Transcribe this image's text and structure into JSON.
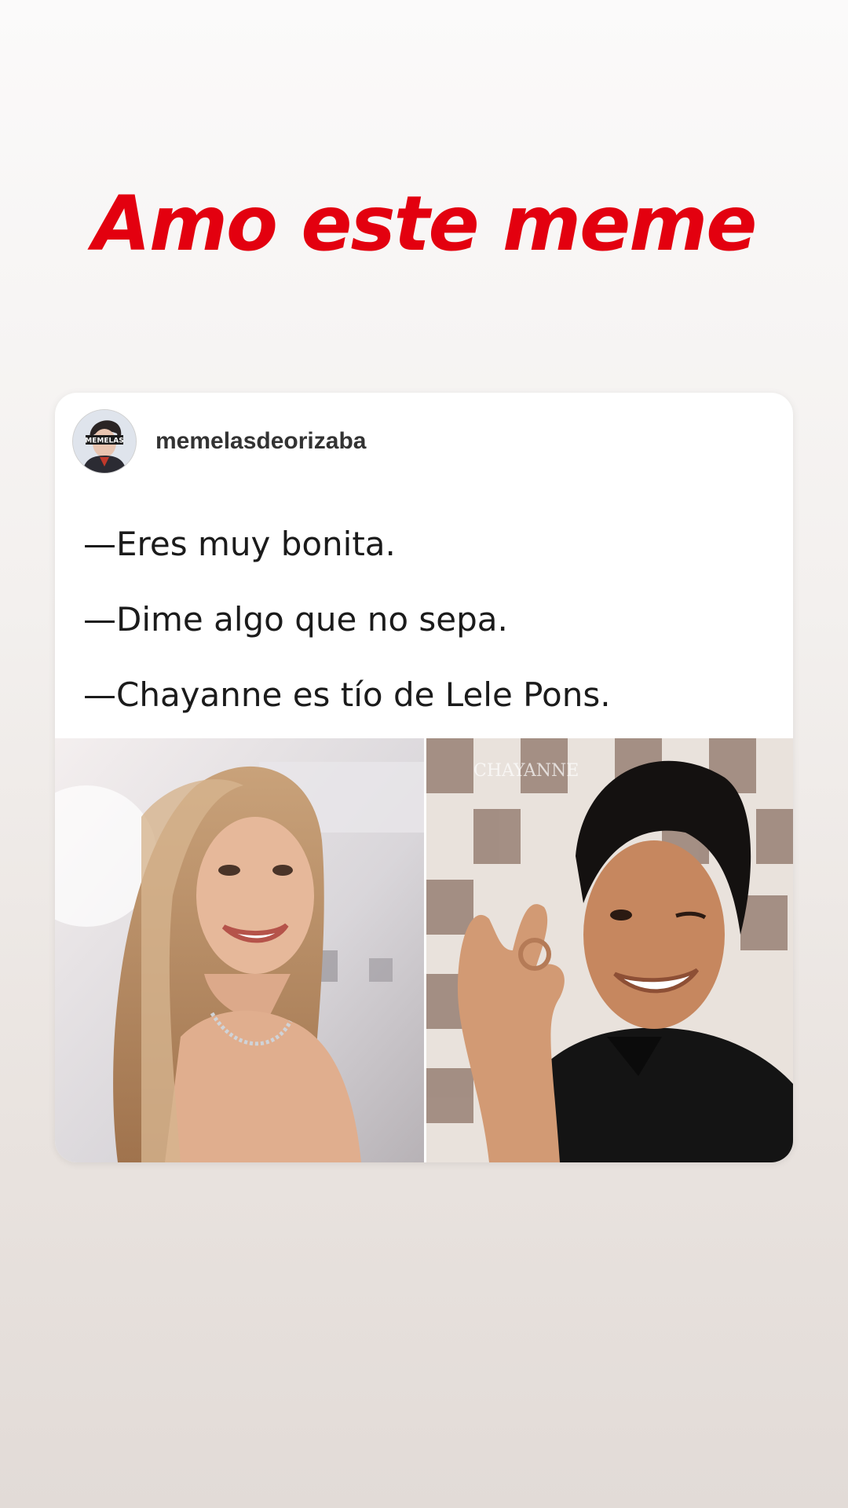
{
  "story": {
    "title_text": "Amo este meme",
    "title_color": "#e3000f"
  },
  "post": {
    "username": "memelasdeorizaba",
    "avatar_badge": "MEMELAS",
    "lines": [
      "—Eres muy bonita.",
      "—Dime algo que no sepa.",
      "—Chayanne es tío de Lele Pons."
    ],
    "photos": [
      {
        "icon": "woman-smiling-photo"
      },
      {
        "icon": "man-winking-ok-gesture-photo",
        "backdrop_text": "CHAYANNE"
      }
    ]
  }
}
